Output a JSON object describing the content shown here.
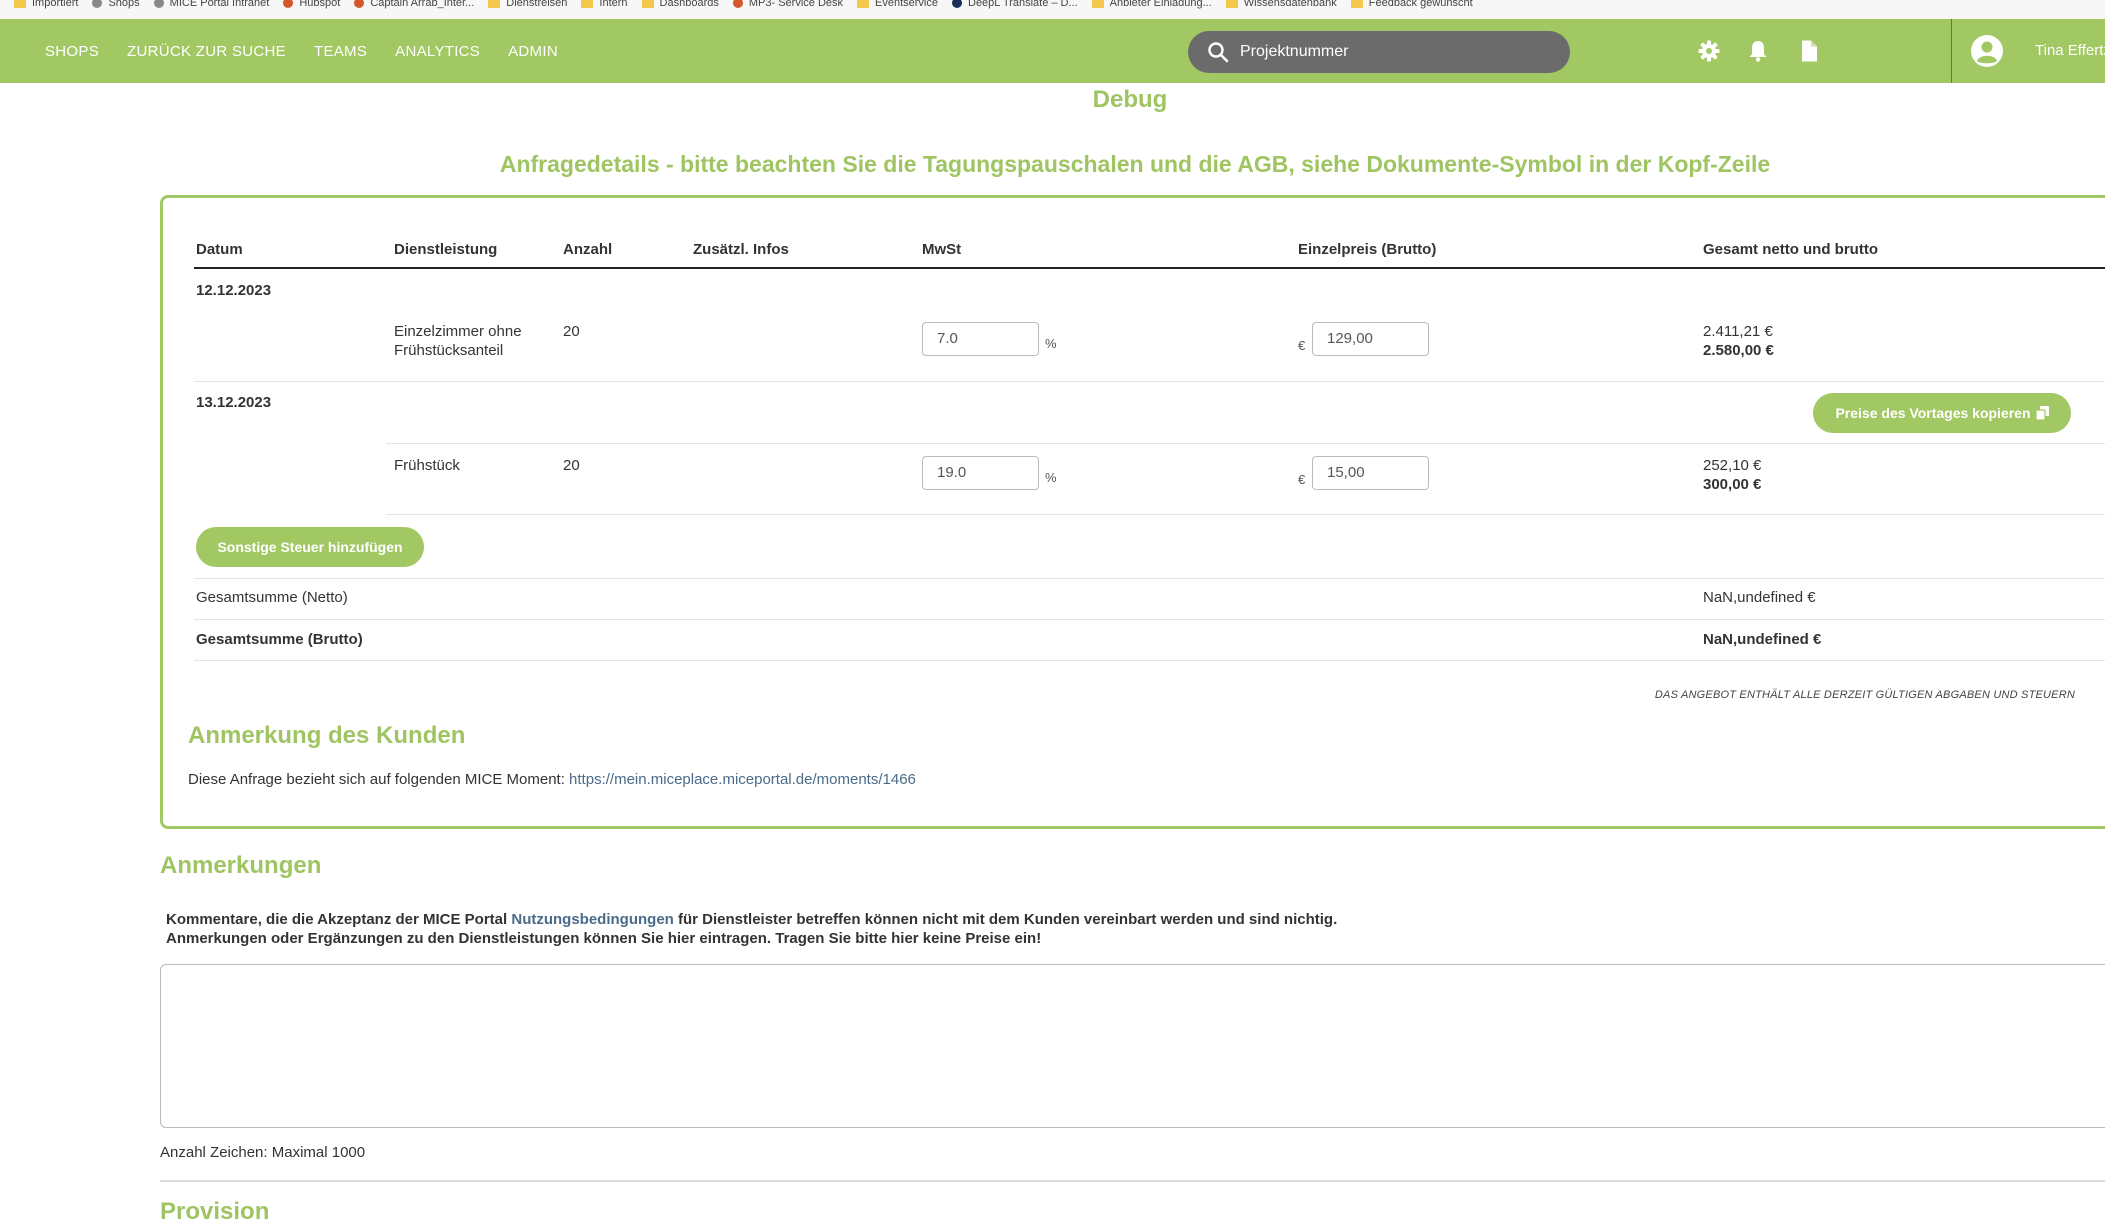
{
  "bookmarks": [
    {
      "label": "Importiert",
      "type": "folder"
    },
    {
      "label": "Shops",
      "type": "site"
    },
    {
      "label": "MICE Portal Intranet",
      "type": "site"
    },
    {
      "label": "Hubspot",
      "type": "site"
    },
    {
      "label": "Captain Arrab_Inter...",
      "type": "site"
    },
    {
      "label": "Dienstreisen",
      "type": "folder"
    },
    {
      "label": "Intern",
      "type": "folder"
    },
    {
      "label": "Dashboards",
      "type": "folder"
    },
    {
      "label": "MP3- Service Desk",
      "type": "site"
    },
    {
      "label": "Eventservice",
      "type": "folder"
    },
    {
      "label": "DeepL Translate – D...",
      "type": "site"
    },
    {
      "label": "Anbieter Einladung...",
      "type": "folder"
    },
    {
      "label": "Wissensdatenbank",
      "type": "folder"
    },
    {
      "label": "Feedback gewünscht",
      "type": "folder"
    }
  ],
  "nav": {
    "links": [
      "SHOPS",
      "ZURÜCK ZUR SUCHE",
      "TEAMS",
      "ANALYTICS",
      "ADMIN"
    ],
    "search_placeholder": "Projektnummer",
    "icons": [
      "gear-icon",
      "bell-icon",
      "document-icon",
      "user-avatar-icon"
    ],
    "username": "Tina Effertz"
  },
  "debug_label": "Debug",
  "page_heading": "Anfragedetails - bitte beachten Sie die Tagungspauschalen und die AGB, siehe Dokumente-Symbol in der Kopf-Zeile",
  "table": {
    "headers": {
      "datum": "Datum",
      "dienstleistung": "Dienstleistung",
      "anzahl": "Anzahl",
      "infos": "Zusätzl. Infos",
      "mwst": "MwSt",
      "einzelpreis": "Einzelpreis (Brutto)",
      "gesamt": "Gesamt netto und brutto"
    },
    "days": [
      {
        "date": "12.12.2023",
        "items": [
          {
            "service_line1": "Einzelzimmer ohne",
            "service_line2": "Frühstücksanteil",
            "count": "20",
            "mwst": "7.0",
            "percent": "%",
            "currency": "€",
            "price": "129,00",
            "netto": "2.411,21 €",
            "brutto": "2.580,00 €"
          }
        ]
      },
      {
        "date": "13.12.2023",
        "copy_button": "Preise des Vortages kopieren",
        "items": [
          {
            "service_line1": "Frühstück",
            "count": "20",
            "mwst": "19.0",
            "percent": "%",
            "currency": "€",
            "price": "15,00",
            "netto": "252,10 €",
            "brutto": "300,00 €"
          }
        ]
      }
    ],
    "add_tax_button": "Sonstige Steuer hinzufügen",
    "sum_netto_label": "Gesamtsumme (Netto)",
    "sum_netto_value": "NaN,undefined €",
    "sum_brutto_label": "Gesamtsumme (Brutto)",
    "sum_brutto_value": "NaN,undefined €",
    "tax_note": "DAS ANGEBOT ENTHÄLT ALLE DERZEIT GÜLTIGEN ABGABEN UND STEUERN"
  },
  "customer_note": {
    "heading": "Anmerkung des Kunden",
    "text": "Diese Anfrage bezieht sich auf folgenden MICE Moment:",
    "link": "https://mein.miceplace.miceportal.de/moments/1466"
  },
  "remarks": {
    "heading": "Anmerkungen",
    "line1_pre": "Kommentare, die die Akzeptanz der MICE Portal",
    "line1_link": "Nutzungsbedingungen",
    "line1_post": "für Dienstleister betreffen können nicht mit dem Kunden vereinbart werden und sind nichtig.",
    "line2": "Anmerkungen oder Ergänzungen zu den Dienstleistungen können Sie hier eintragen. Tragen Sie bitte hier keine Preise ein!",
    "textarea_value": "",
    "char_limit": "Anzahl Zeichen: Maximal 1000"
  },
  "provision_heading": "Provision",
  "colors": {
    "accent": "#a2c864",
    "accent_text": "#9fc562",
    "search_bg": "#6b6b6b"
  }
}
